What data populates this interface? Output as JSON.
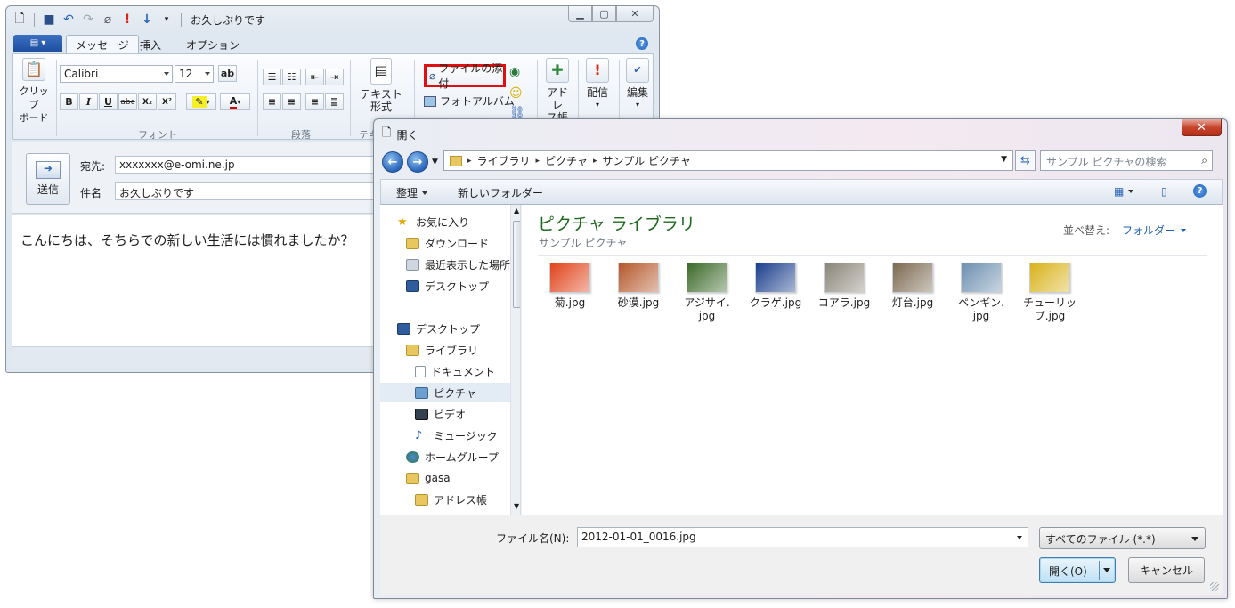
{
  "mail": {
    "title": "お久しぶりです",
    "tabs": [
      "メッセージ",
      "挿入",
      "オプション"
    ],
    "ribbon": {
      "clipboard_label": "クリップ\nボード",
      "font_name": "Calibri",
      "font_size": "12",
      "font_group": "フォント",
      "paragraph_group": "段落",
      "text_format": "テキスト\n形式",
      "text_group_partial": "テキ",
      "attach_file": "ファイルの添付",
      "photo_album": "フォトアルバム",
      "address_book": "アドレ\nス帳",
      "delivery": "配信",
      "edit": "編集",
      "format_buttons": [
        "B",
        "I",
        "U",
        "abc",
        "X₂",
        "X²"
      ]
    },
    "header": {
      "send_label": "送信",
      "to_label": "宛先:",
      "to_value": "xxxxxxx@e-omi.ne.jp",
      "subject_label": "件名",
      "subject_value": "お久しぶりです"
    },
    "body_text": "こんにちは、そちらでの新しい生活には慣れましたか？"
  },
  "dialog": {
    "title": "開く",
    "breadcrumb": [
      "ライブラリ",
      "ピクチャ",
      "サンプル ピクチャ"
    ],
    "search_placeholder": "サンプル ピクチャの検索",
    "organize": "整理",
    "new_folder": "新しいフォルダー",
    "nav": [
      {
        "label": "お気に入り",
        "icon": "star-icon"
      },
      {
        "label": "ダウンロード",
        "icon": "download-folder-icon"
      },
      {
        "label": "最近表示した場所",
        "icon": "recent-places-icon"
      },
      {
        "label": "デスクトップ",
        "icon": "desktop-icon"
      },
      {
        "label": "デスクトップ",
        "icon": "desktop-icon"
      },
      {
        "label": "ライブラリ",
        "icon": "library-icon"
      },
      {
        "label": "ドキュメント",
        "icon": "document-icon"
      },
      {
        "label": "ピクチャ",
        "icon": "picture-icon"
      },
      {
        "label": "ビデオ",
        "icon": "video-icon"
      },
      {
        "label": "ミュージック",
        "icon": "music-icon"
      },
      {
        "label": "ホームグループ",
        "icon": "homegroup-icon"
      },
      {
        "label": "gasa",
        "icon": "user-folder-icon"
      },
      {
        "label": "アドレス帳",
        "icon": "address-book-icon"
      }
    ],
    "library_title": "ピクチャ ライブラリ",
    "library_sub": "サンプル ピクチャ",
    "sort_label": "並べ替え:",
    "sort_value": "フォルダー",
    "files": [
      {
        "name": "菊.jpg",
        "color": "#e0431a"
      },
      {
        "name": "砂漠.jpg",
        "color": "#b5582b"
      },
      {
        "name": "アジサイ.\njpg",
        "color": "#3d6a2a"
      },
      {
        "name": "クラゲ.jpg",
        "color": "#1c3f8c"
      },
      {
        "name": "コアラ.jpg",
        "color": "#8a8578"
      },
      {
        "name": "灯台.jpg",
        "color": "#7c6a52"
      },
      {
        "name": "ペンギン.\njpg",
        "color": "#6d8fb0"
      },
      {
        "name": "チューリッ\nプ.jpg",
        "color": "#d9b21a"
      }
    ],
    "filename_label": "ファイル名(N):",
    "filename_value": "2012-01-01_0016.jpg",
    "filetype": "すべてのファイル (*.*)",
    "open_button": "開く(O)",
    "cancel_button": "キャンセル"
  }
}
